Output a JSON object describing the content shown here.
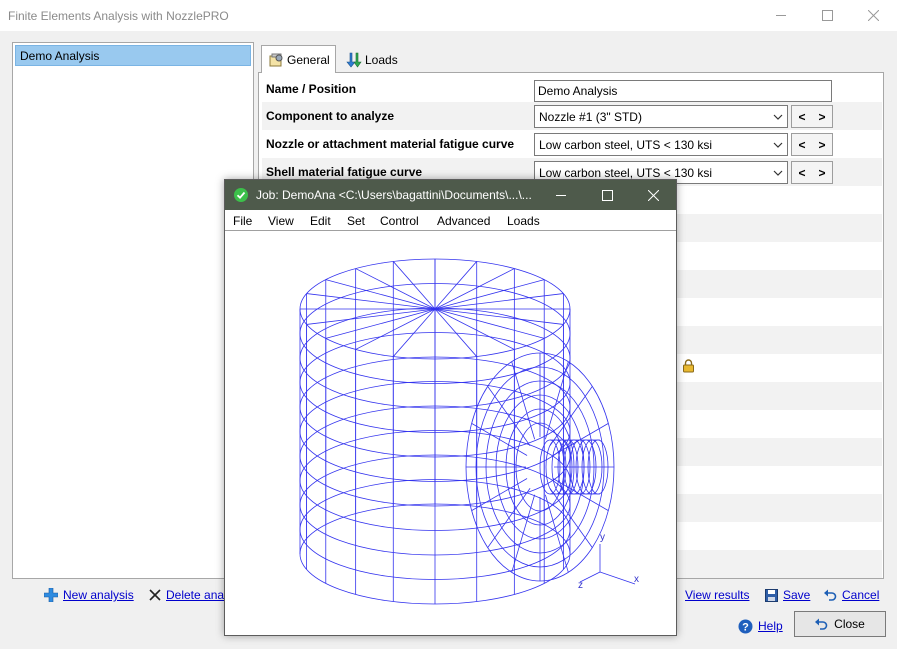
{
  "app": {
    "title": "Finite Elements Analysis with NozzlePRO"
  },
  "analyses": [
    "Demo Analysis"
  ],
  "tabs": [
    {
      "label": "General",
      "icon": "general-settings-icon"
    },
    {
      "label": "Loads",
      "icon": "loads-arrows-icon"
    }
  ],
  "general": {
    "name_label": "Name / Position",
    "name_value": "Demo Analysis",
    "component_label": "Component to analyze",
    "component_value": "Nozzle #1 (3\" STD)",
    "nozzle_curve_label": "Nozzle or attachment material fatigue curve",
    "nozzle_curve_value": "Low carbon steel, UTS < 130 ksi",
    "shell_curve_label": "Shell material fatigue curve",
    "shell_curve_value": "Low carbon steel, UTS < 130 ksi",
    "prev": "<",
    "next": ">"
  },
  "actions": {
    "new_analysis": "New analysis",
    "delete_analysis": "Delete anal",
    "view_results": "View results",
    "save": "Save",
    "cancel": "Cancel",
    "help": "Help",
    "close": "Close"
  },
  "job_window": {
    "title": "Job: DemoAna <C:\\Users\\bagattini\\Documents\\...\\...",
    "menu": [
      "File",
      "View",
      "Edit",
      "Set",
      "Control",
      "Advanced",
      "Loads"
    ],
    "axes": {
      "x": "x",
      "y": "y",
      "z": "z"
    },
    "mesh_color": "#3333ee"
  },
  "colors": {
    "selection": "#99c9ef",
    "job_titlebar": "#4e5a4b",
    "link": "#0000cc"
  }
}
